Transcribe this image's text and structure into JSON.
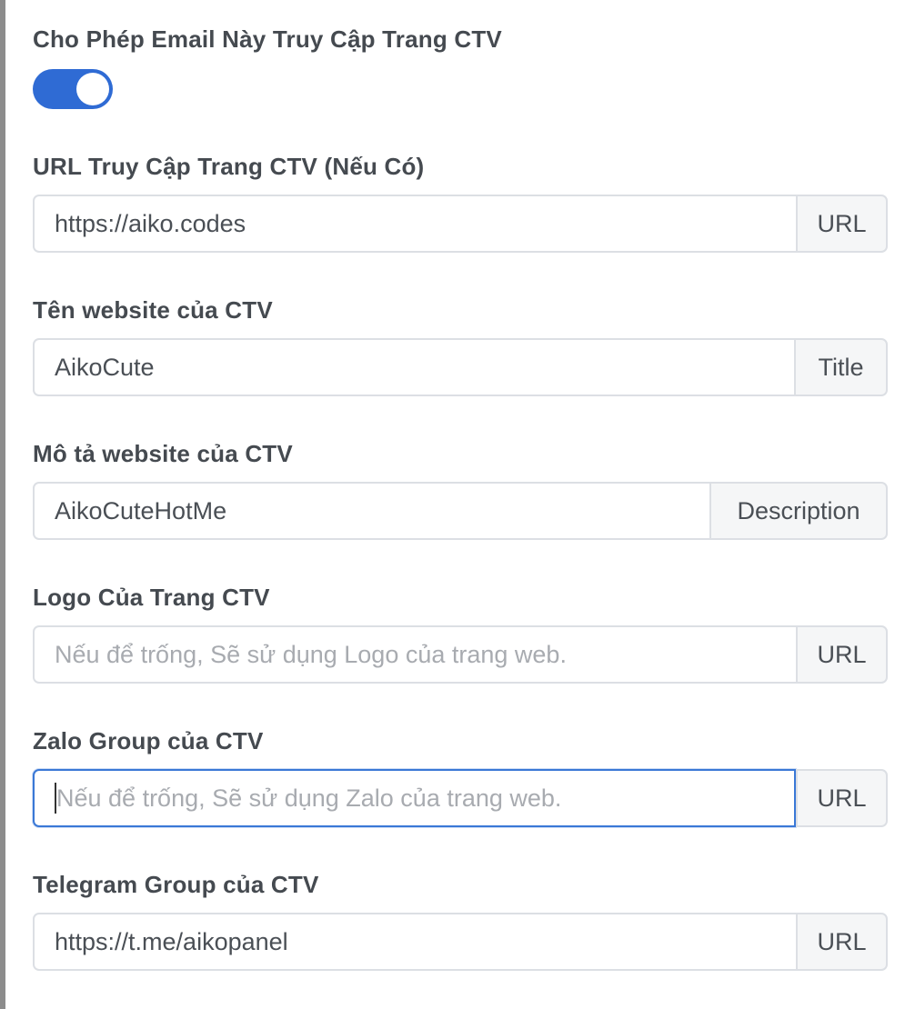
{
  "form": {
    "allow_access": {
      "label": "Cho Phép Email Này Truy Cập Trang CTV",
      "enabled": true
    },
    "fields": [
      {
        "label": "URL Truy Cập Trang CTV (Nếu Có)",
        "value": "https://aiko.codes",
        "placeholder": "",
        "addon": "URL"
      },
      {
        "label": "Tên website của CTV",
        "value": "AikoCute",
        "placeholder": "",
        "addon": "Title"
      },
      {
        "label": "Mô tả website của CTV",
        "value": "AikoCuteHotMe",
        "placeholder": "",
        "addon": "Description"
      },
      {
        "label": "Logo Của Trang CTV",
        "value": "",
        "placeholder": "Nếu để trống, Sẽ sử dụng Logo của trang web.",
        "addon": "URL"
      },
      {
        "label": "Zalo Group của CTV",
        "value": "",
        "placeholder": "Nếu để trống, Sẽ sử dụng Zalo của trang web.",
        "addon": "URL"
      },
      {
        "label": "Telegram Group của CTV",
        "value": "https://t.me/aikopanel",
        "placeholder": "",
        "addon": "URL"
      }
    ]
  },
  "colors": {
    "toggle_on": "#2f6bd4",
    "focus_border": "#3a78d6"
  }
}
